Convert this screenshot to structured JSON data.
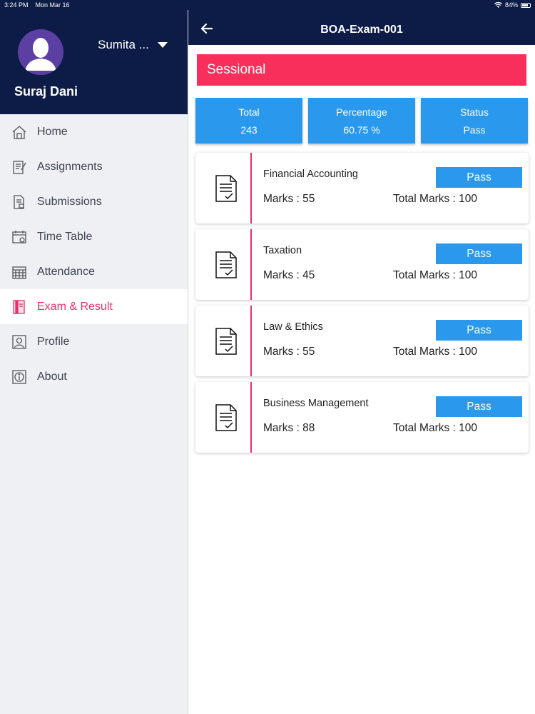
{
  "status_bar": {
    "time": "3:24 PM",
    "date": "Mon Mar 16",
    "battery": "84%",
    "battery_level": 0.84
  },
  "sidebar": {
    "switch_name": "Sumita ...",
    "user_name": "Suraj Dani",
    "items": [
      {
        "label": "Home",
        "icon": "home-icon"
      },
      {
        "label": "Assignments",
        "icon": "assignment-icon"
      },
      {
        "label": "Submissions",
        "icon": "submission-icon"
      },
      {
        "label": "Time Table",
        "icon": "calendar-icon"
      },
      {
        "label": "Attendance",
        "icon": "attendance-calendar-icon"
      },
      {
        "label": "Exam & Result",
        "icon": "exam-result-icon",
        "active": true
      },
      {
        "label": "Profile",
        "icon": "profile-icon"
      },
      {
        "label": "About",
        "icon": "info-icon"
      }
    ]
  },
  "header": {
    "title": "BOA-Exam-001"
  },
  "banner": {
    "label": "Sessional"
  },
  "summary": {
    "total_label": "Total",
    "total_value": "243",
    "percentage_label": "Percentage",
    "percentage_value": "60.75 %",
    "status_label": "Status",
    "status_value": "Pass"
  },
  "results": [
    {
      "subject": "Financial Accounting",
      "status": "Pass",
      "marks": "Marks : 55",
      "total": "Total Marks : 100"
    },
    {
      "subject": "Taxation",
      "status": "Pass",
      "marks": "Marks : 45",
      "total": "Total Marks : 100"
    },
    {
      "subject": "Law & Ethics",
      "status": "Pass",
      "marks": "Marks : 55",
      "total": "Total Marks : 100"
    },
    {
      "subject": "Business Management",
      "status": "Pass",
      "marks": "Marks : 88",
      "total": "Total Marks : 100"
    }
  ],
  "colors": {
    "navy": "#0d1c46",
    "accent_pink": "#e53068",
    "banner_red": "#f72f5a",
    "blue": "#2a98ec"
  }
}
